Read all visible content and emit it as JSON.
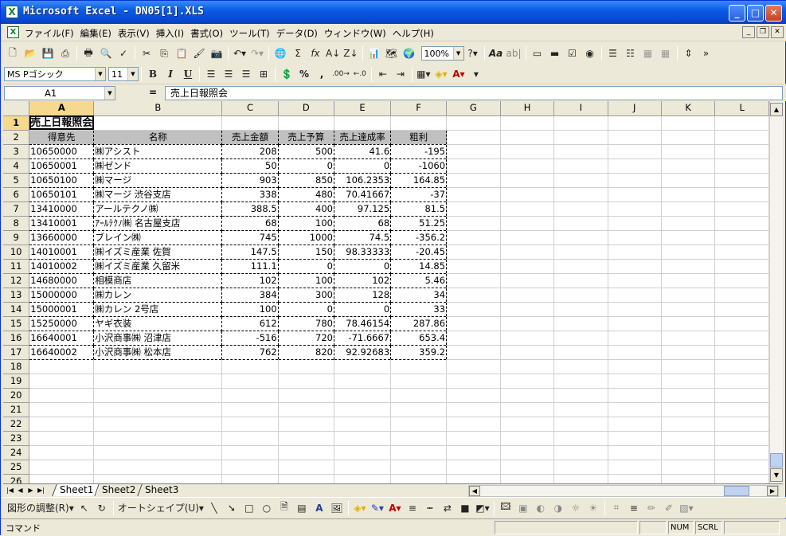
{
  "window": {
    "title": "Microsoft Excel - DN05[1].XLS",
    "app_icon": "X"
  },
  "menu": [
    "ファイル(F)",
    "編集(E)",
    "表示(V)",
    "挿入(I)",
    "書式(O)",
    "ツール(T)",
    "データ(D)",
    "ウィンドウ(W)",
    "ヘルプ(H)"
  ],
  "toolbar": {
    "zoom": "100%"
  },
  "format": {
    "font": "MS Pゴシック",
    "size": "11",
    "bold": "B",
    "italic": "I",
    "underline": "U",
    "percent": "%",
    "comma": ","
  },
  "formula": {
    "cell": "A1",
    "eq": "=",
    "value": "売上日報照会"
  },
  "columns": [
    "A",
    "B",
    "C",
    "D",
    "E",
    "F",
    "G",
    "H",
    "I",
    "J",
    "K",
    "L"
  ],
  "sheet": {
    "title": "売上日報照会",
    "headers": [
      "得意先",
      "名称",
      "売上金額",
      "売上予算",
      "売上達成率",
      "粗利"
    ],
    "rows": [
      [
        "10650000",
        "㈱アシスト",
        "208",
        "500",
        "41.6",
        "-195"
      ],
      [
        "10650001",
        "㈱ゼンド",
        "50",
        "0",
        "0",
        "-1060"
      ],
      [
        "10650100",
        "㈱マージ",
        "903",
        "850",
        "106.2353",
        "164.85"
      ],
      [
        "10650101",
        "㈱マージ 渋谷支店",
        "338",
        "480",
        "70.41667",
        "-37"
      ],
      [
        "13410000",
        "アールテクノ㈱",
        "388.5",
        "400",
        "97.125",
        "81.5"
      ],
      [
        "13410001",
        "ｱｰﾙﾃｸﾉ㈱ 名古屋支店",
        "68",
        "100",
        "68",
        "51.25"
      ],
      [
        "13660000",
        "ブレイン㈱",
        "745",
        "1000",
        "74.5",
        "-356.2"
      ],
      [
        "14010001",
        "㈱イズミ産業 佐賀",
        "147.5",
        "150",
        "98.33333",
        "-20.45"
      ],
      [
        "14010002",
        "㈱イズミ産業 久留米",
        "111.1",
        "0",
        "0",
        "14.85"
      ],
      [
        "14680000",
        "相模商店",
        "102",
        "100",
        "102",
        "5.46"
      ],
      [
        "15000000",
        "㈱カレン",
        "384",
        "300",
        "128",
        "34"
      ],
      [
        "15000001",
        "㈱カレン 2号店",
        "100",
        "0",
        "0",
        "33"
      ],
      [
        "15250000",
        "ヤギ衣装",
        "612",
        "780",
        "78.46154",
        "287.86"
      ],
      [
        "16640001",
        "小沢商事㈱ 沼津店",
        "-516",
        "720",
        "-71.6667",
        "653.4"
      ],
      [
        "16640002",
        "小沢商事㈱ 松本店",
        "762",
        "820",
        "92.92683",
        "359.2"
      ]
    ],
    "empty_rows": [
      "18",
      "19",
      "20",
      "21",
      "22",
      "23",
      "24",
      "25",
      "26"
    ]
  },
  "tabs": [
    "Sheet1",
    "Sheet2",
    "Sheet3"
  ],
  "drawbar": {
    "adjust": "図形の調整(R)",
    "autoshape": "オートシェイプ(U)"
  },
  "status": {
    "left": "コマンド",
    "num": "NUM",
    "scrl": "SCRL"
  }
}
